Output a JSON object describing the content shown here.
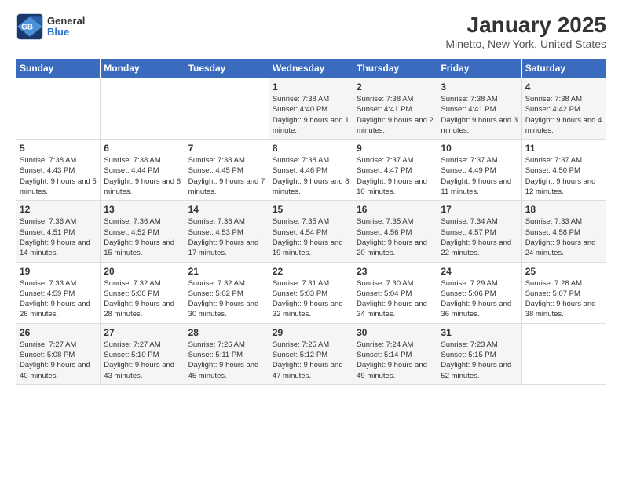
{
  "header": {
    "logo_general": "General",
    "logo_blue": "Blue",
    "title": "January 2025",
    "subtitle": "Minetto, New York, United States"
  },
  "weekdays": [
    "Sunday",
    "Monday",
    "Tuesday",
    "Wednesday",
    "Thursday",
    "Friday",
    "Saturday"
  ],
  "weeks": [
    [
      {
        "day": "",
        "sunrise": "",
        "sunset": "",
        "daylight": ""
      },
      {
        "day": "",
        "sunrise": "",
        "sunset": "",
        "daylight": ""
      },
      {
        "day": "",
        "sunrise": "",
        "sunset": "",
        "daylight": ""
      },
      {
        "day": "1",
        "sunrise": "Sunrise: 7:38 AM",
        "sunset": "Sunset: 4:40 PM",
        "daylight": "Daylight: 9 hours and 1 minute."
      },
      {
        "day": "2",
        "sunrise": "Sunrise: 7:38 AM",
        "sunset": "Sunset: 4:41 PM",
        "daylight": "Daylight: 9 hours and 2 minutes."
      },
      {
        "day": "3",
        "sunrise": "Sunrise: 7:38 AM",
        "sunset": "Sunset: 4:41 PM",
        "daylight": "Daylight: 9 hours and 3 minutes."
      },
      {
        "day": "4",
        "sunrise": "Sunrise: 7:38 AM",
        "sunset": "Sunset: 4:42 PM",
        "daylight": "Daylight: 9 hours and 4 minutes."
      }
    ],
    [
      {
        "day": "5",
        "sunrise": "Sunrise: 7:38 AM",
        "sunset": "Sunset: 4:43 PM",
        "daylight": "Daylight: 9 hours and 5 minutes."
      },
      {
        "day": "6",
        "sunrise": "Sunrise: 7:38 AM",
        "sunset": "Sunset: 4:44 PM",
        "daylight": "Daylight: 9 hours and 6 minutes."
      },
      {
        "day": "7",
        "sunrise": "Sunrise: 7:38 AM",
        "sunset": "Sunset: 4:45 PM",
        "daylight": "Daylight: 9 hours and 7 minutes."
      },
      {
        "day": "8",
        "sunrise": "Sunrise: 7:38 AM",
        "sunset": "Sunset: 4:46 PM",
        "daylight": "Daylight: 9 hours and 8 minutes."
      },
      {
        "day": "9",
        "sunrise": "Sunrise: 7:37 AM",
        "sunset": "Sunset: 4:47 PM",
        "daylight": "Daylight: 9 hours and 10 minutes."
      },
      {
        "day": "10",
        "sunrise": "Sunrise: 7:37 AM",
        "sunset": "Sunset: 4:49 PM",
        "daylight": "Daylight: 9 hours and 11 minutes."
      },
      {
        "day": "11",
        "sunrise": "Sunrise: 7:37 AM",
        "sunset": "Sunset: 4:50 PM",
        "daylight": "Daylight: 9 hours and 12 minutes."
      }
    ],
    [
      {
        "day": "12",
        "sunrise": "Sunrise: 7:36 AM",
        "sunset": "Sunset: 4:51 PM",
        "daylight": "Daylight: 9 hours and 14 minutes."
      },
      {
        "day": "13",
        "sunrise": "Sunrise: 7:36 AM",
        "sunset": "Sunset: 4:52 PM",
        "daylight": "Daylight: 9 hours and 15 minutes."
      },
      {
        "day": "14",
        "sunrise": "Sunrise: 7:36 AM",
        "sunset": "Sunset: 4:53 PM",
        "daylight": "Daylight: 9 hours and 17 minutes."
      },
      {
        "day": "15",
        "sunrise": "Sunrise: 7:35 AM",
        "sunset": "Sunset: 4:54 PM",
        "daylight": "Daylight: 9 hours and 19 minutes."
      },
      {
        "day": "16",
        "sunrise": "Sunrise: 7:35 AM",
        "sunset": "Sunset: 4:56 PM",
        "daylight": "Daylight: 9 hours and 20 minutes."
      },
      {
        "day": "17",
        "sunrise": "Sunrise: 7:34 AM",
        "sunset": "Sunset: 4:57 PM",
        "daylight": "Daylight: 9 hours and 22 minutes."
      },
      {
        "day": "18",
        "sunrise": "Sunrise: 7:33 AM",
        "sunset": "Sunset: 4:58 PM",
        "daylight": "Daylight: 9 hours and 24 minutes."
      }
    ],
    [
      {
        "day": "19",
        "sunrise": "Sunrise: 7:33 AM",
        "sunset": "Sunset: 4:59 PM",
        "daylight": "Daylight: 9 hours and 26 minutes."
      },
      {
        "day": "20",
        "sunrise": "Sunrise: 7:32 AM",
        "sunset": "Sunset: 5:00 PM",
        "daylight": "Daylight: 9 hours and 28 minutes."
      },
      {
        "day": "21",
        "sunrise": "Sunrise: 7:32 AM",
        "sunset": "Sunset: 5:02 PM",
        "daylight": "Daylight: 9 hours and 30 minutes."
      },
      {
        "day": "22",
        "sunrise": "Sunrise: 7:31 AM",
        "sunset": "Sunset: 5:03 PM",
        "daylight": "Daylight: 9 hours and 32 minutes."
      },
      {
        "day": "23",
        "sunrise": "Sunrise: 7:30 AM",
        "sunset": "Sunset: 5:04 PM",
        "daylight": "Daylight: 9 hours and 34 minutes."
      },
      {
        "day": "24",
        "sunrise": "Sunrise: 7:29 AM",
        "sunset": "Sunset: 5:06 PM",
        "daylight": "Daylight: 9 hours and 36 minutes."
      },
      {
        "day": "25",
        "sunrise": "Sunrise: 7:28 AM",
        "sunset": "Sunset: 5:07 PM",
        "daylight": "Daylight: 9 hours and 38 minutes."
      }
    ],
    [
      {
        "day": "26",
        "sunrise": "Sunrise: 7:27 AM",
        "sunset": "Sunset: 5:08 PM",
        "daylight": "Daylight: 9 hours and 40 minutes."
      },
      {
        "day": "27",
        "sunrise": "Sunrise: 7:27 AM",
        "sunset": "Sunset: 5:10 PM",
        "daylight": "Daylight: 9 hours and 43 minutes."
      },
      {
        "day": "28",
        "sunrise": "Sunrise: 7:26 AM",
        "sunset": "Sunset: 5:11 PM",
        "daylight": "Daylight: 9 hours and 45 minutes."
      },
      {
        "day": "29",
        "sunrise": "Sunrise: 7:25 AM",
        "sunset": "Sunset: 5:12 PM",
        "daylight": "Daylight: 9 hours and 47 minutes."
      },
      {
        "day": "30",
        "sunrise": "Sunrise: 7:24 AM",
        "sunset": "Sunset: 5:14 PM",
        "daylight": "Daylight: 9 hours and 49 minutes."
      },
      {
        "day": "31",
        "sunrise": "Sunrise: 7:23 AM",
        "sunset": "Sunset: 5:15 PM",
        "daylight": "Daylight: 9 hours and 52 minutes."
      },
      {
        "day": "",
        "sunrise": "",
        "sunset": "",
        "daylight": ""
      }
    ]
  ]
}
